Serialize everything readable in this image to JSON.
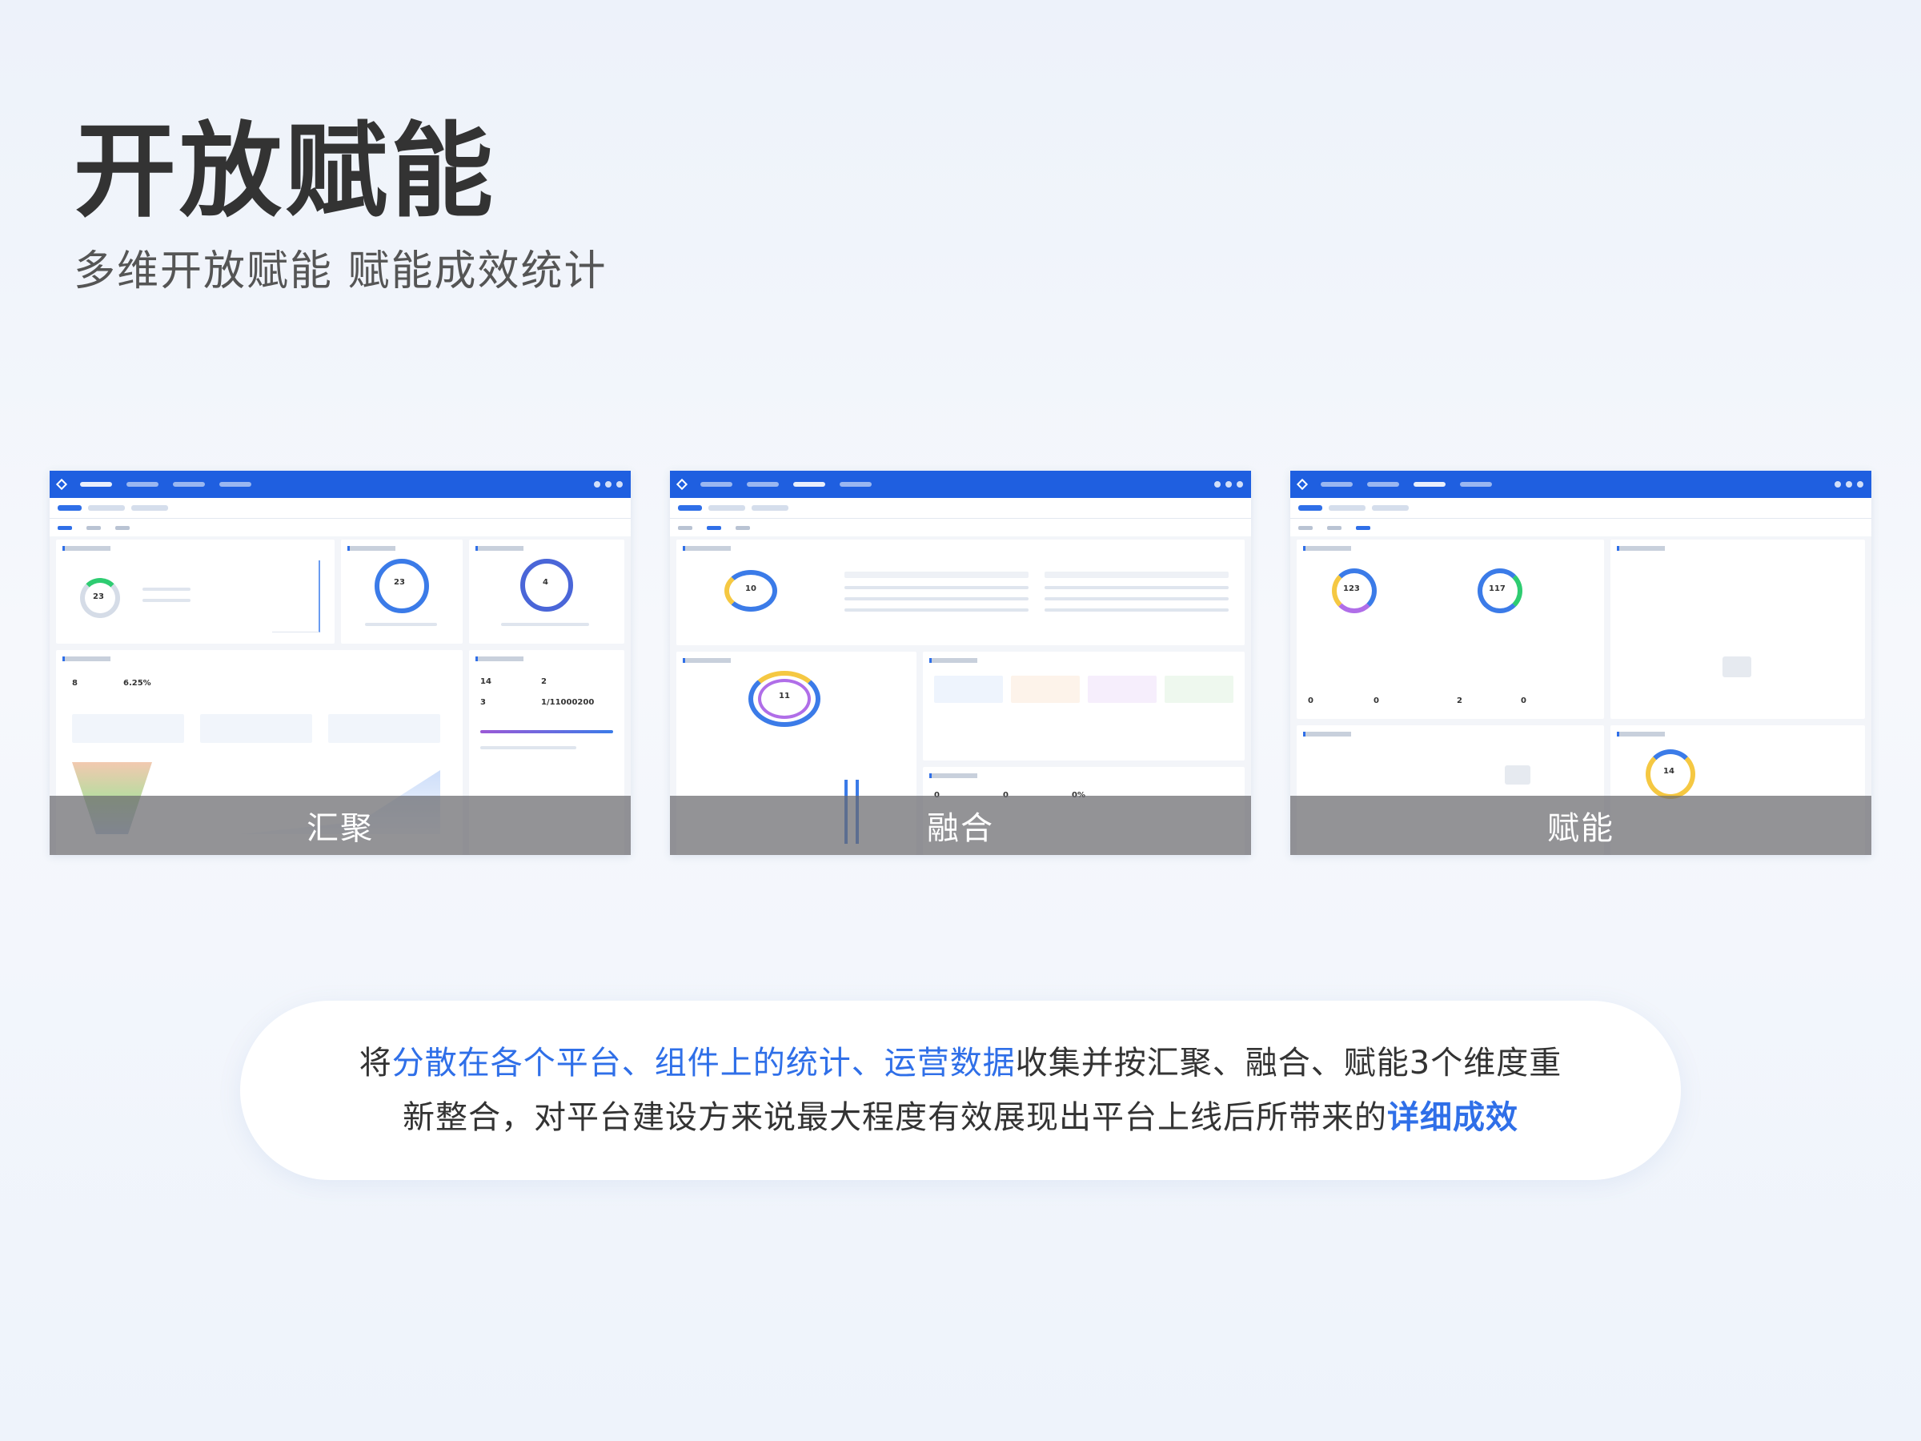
{
  "header": {
    "title": "开放赋能",
    "subtitle": "多维开放赋能  赋能成效统计"
  },
  "screenshots": [
    {
      "label": "汇聚",
      "ring1": "23",
      "ring2": "23",
      "ring3": "4",
      "stat1": "8",
      "stat2": "6.25%",
      "stat3": "14",
      "stat4": "2",
      "stat5": "3",
      "stat6": "1/11000200"
    },
    {
      "label": "融合",
      "ring1": "10",
      "ring2": "11",
      "stat1": "0",
      "stat2": "0",
      "stat3": "0%"
    },
    {
      "label": "赋能",
      "ring1": "123",
      "ring2": "117",
      "ring3": "14",
      "stat1": "0",
      "stat2": "0",
      "stat3": "2",
      "stat4": "0"
    }
  ],
  "description": {
    "line1_prefix": "将",
    "line1_highlight": "分散在各个平台、组件上的统计、运营数据",
    "line1_suffix": "收集并按汇聚、融合、赋能3个维度重",
    "line2_prefix": "新整合，对平台建设方来说最大程度有效展现出平台上线后所带来的",
    "line2_highlight": "详细成效"
  },
  "colors": {
    "accent": "#2f6fe8",
    "topbar": "#1f5fe0",
    "overlay": "#69696e"
  }
}
